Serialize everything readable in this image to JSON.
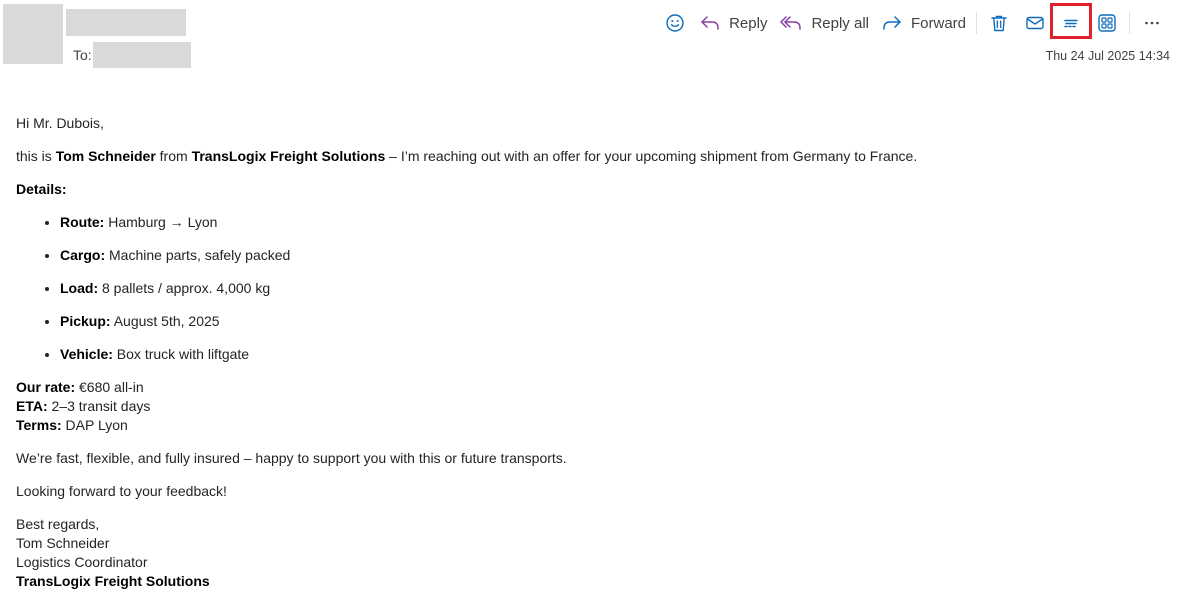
{
  "header": {
    "to_label": "To:",
    "date": "Thu 24 Jul 2025 14:34"
  },
  "toolbar": {
    "reply_label": "Reply",
    "reply_all_label": "Reply all",
    "forward_label": "Forward",
    "icons": [
      "emoji-icon",
      "reply-icon",
      "reply-all-icon",
      "forward-icon",
      "delete-icon",
      "mail-icon",
      "immersive-reader-icon",
      "apps-icon",
      "more-icon"
    ],
    "accent_color": "#0f6cbd",
    "reply_color": "#8a3fa8"
  },
  "email": {
    "greeting": "Hi Mr. Dubois,",
    "intro_pre": "this is ",
    "sender_name": "Tom Schneider",
    "intro_mid": " from ",
    "company": "TransLogix Freight Solutions",
    "intro_post": " – I’m reaching out with an offer for your upcoming shipment from Germany to France.",
    "details_heading": "Details:",
    "details": [
      {
        "label": "Route:",
        "value": " Hamburg → Lyon"
      },
      {
        "label": "Cargo:",
        "value": " Machine parts, safely packed"
      },
      {
        "label": "Load:",
        "value": " 8 pallets / approx. 4,000 kg"
      },
      {
        "label": "Pickup:",
        "value": " August 5th, 2025"
      },
      {
        "label": "Vehicle:",
        "value": " Box truck with liftgate"
      }
    ],
    "rate_label": "Our rate:",
    "rate_value": " €680 all-in",
    "eta_label": "ETA:",
    "eta_value": " 2–3 transit days",
    "terms_label": "Terms:",
    "terms_value": " DAP Lyon",
    "pitch": "We’re fast, flexible, and fully insured – happy to support you with this or future transports.",
    "closing": "Looking forward to your feedback!",
    "signoff": "Best regards,",
    "sig_name": "Tom Schneider",
    "sig_title": "Logistics Coordinator",
    "sig_company": "TransLogix Freight Solutions"
  }
}
